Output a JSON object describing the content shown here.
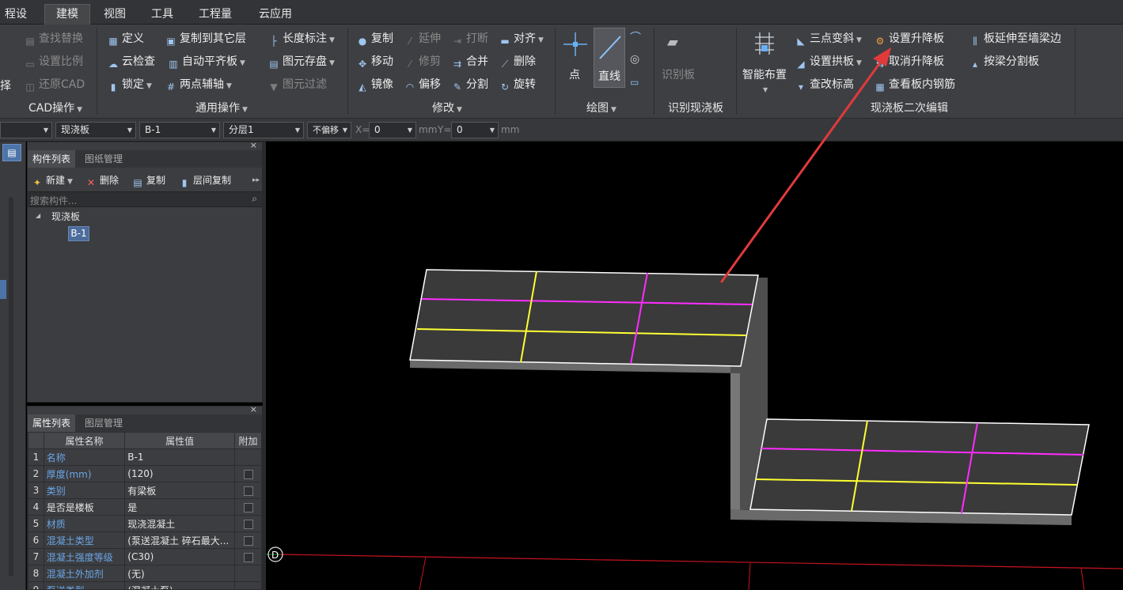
{
  "menu": {
    "tabs": [
      {
        "label": "程设置"
      },
      {
        "label": "建模"
      },
      {
        "label": "视图"
      },
      {
        "label": "工具"
      },
      {
        "label": "工程量"
      },
      {
        "label": "云应用"
      }
    ]
  },
  "ribbon": {
    "cad": {
      "find_replace": "查找替换",
      "set_scale": "设置比例",
      "restore_cad": "还原CAD",
      "group_label": "CAD操作",
      "edge_char": "择"
    },
    "common": {
      "define": "定义",
      "copy_to_floor": "复制到其它层",
      "length_dim": "长度标注",
      "cloud_check": "云检查",
      "auto_align": "自动平齐板",
      "save_elements": "图元存盘",
      "lock": "锁定",
      "two_point_axis": "两点辅轴",
      "filter_elements": "图元过滤",
      "group_label": "通用操作"
    },
    "modify": {
      "copy": "复制",
      "extend": "延伸",
      "break": "打断",
      "align": "对齐",
      "move": "移动",
      "trim": "修剪",
      "merge": "合并",
      "delete": "删除",
      "mirror": "镜像",
      "offset": "偏移",
      "split": "分割",
      "rotate": "旋转",
      "group_label": "修改"
    },
    "draw": {
      "point": "点",
      "line": "直线",
      "group_label": "绘图"
    },
    "identify": {
      "identify_slab": "识别板",
      "group_label": "识别现浇板"
    },
    "edit": {
      "smart_layout": "智能布置",
      "three_point_slope": "三点变斜",
      "set_lift_slab": "设置升降板",
      "extend_to_beam": "板延伸至墙梁边",
      "set_arch_slab": "设置拱板",
      "cancel_lift_slab": "取消升降板",
      "split_by_beam": "按梁分割板",
      "check_elevation": "查改标高",
      "view_rebar": "查看板内钢筋",
      "group_label": "现浇板二次编辑"
    }
  },
  "toolbar": {
    "type_value": "现浇板",
    "name_value": "B-1",
    "layer_value": "分层1",
    "offset_value": "不偏移",
    "x_label": "X=",
    "x_value": "0",
    "y_label": "Y=",
    "y_value": "0",
    "unit": "mm"
  },
  "component_panel": {
    "tab_components": "构件列表",
    "tab_drawings": "图纸管理",
    "new": "新建",
    "delete": "删除",
    "copy": "复制",
    "floor_copy": "层间复制",
    "search_placeholder": "搜索构件...",
    "tree_root": "现浇板",
    "tree_item": "B-1"
  },
  "property_panel": {
    "tab_properties": "属性列表",
    "tab_layers": "图层管理",
    "headers": {
      "name": "属性名称",
      "value": "属性值",
      "extra": "附加"
    },
    "rows": [
      {
        "num": "1",
        "name": "名称",
        "value": "B-1",
        "link": true,
        "check": false
      },
      {
        "num": "2",
        "name": "厚度(mm)",
        "value": "(120)",
        "link": true,
        "check": true
      },
      {
        "num": "3",
        "name": "类别",
        "value": "有梁板",
        "link": true,
        "check": true
      },
      {
        "num": "4",
        "name": "是否是楼板",
        "value": "是",
        "link": false,
        "check": true
      },
      {
        "num": "5",
        "name": "材质",
        "value": "现浇混凝土",
        "link": true,
        "check": true
      },
      {
        "num": "6",
        "name": "混凝土类型",
        "value": "(泵送混凝土 碎石最大...",
        "link": true,
        "check": true
      },
      {
        "num": "7",
        "name": "混凝土强度等级",
        "value": "(C30)",
        "link": true,
        "check": true
      },
      {
        "num": "8",
        "name": "混凝土外加剂",
        "value": "(无)",
        "link": true,
        "check": false
      },
      {
        "num": "9",
        "name": "泵送类型",
        "value": "(混凝土泵)",
        "link": true,
        "check": false
      }
    ]
  },
  "canvas": {
    "axis_label": "D"
  },
  "colors": {
    "annotation_arrow": "#e03a3a",
    "grid_magenta": "#ff2cff",
    "grid_yellow": "#ffff33",
    "slab_top": "#3a3a3a",
    "slab_outline": "#ffffff"
  }
}
